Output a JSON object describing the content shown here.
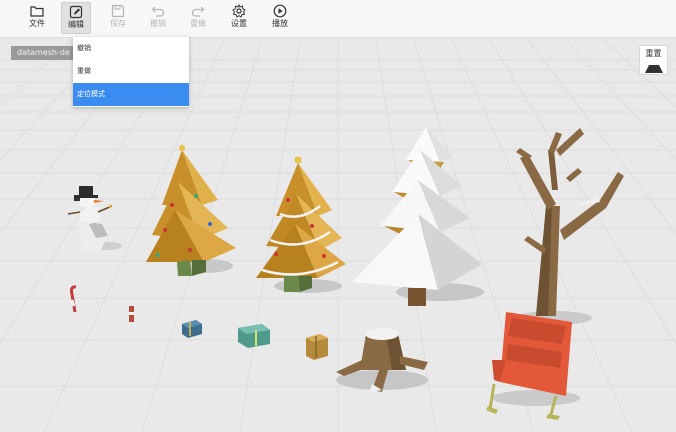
{
  "toolbar": {
    "items": [
      {
        "label": "文件",
        "icon": "folder-icon"
      },
      {
        "label": "编辑",
        "icon": "edit-icon"
      },
      {
        "label": "保存",
        "icon": "save-icon"
      },
      {
        "label": "撤销",
        "icon": "undo-icon"
      },
      {
        "label": "重做",
        "icon": "redo-icon"
      },
      {
        "label": "设置",
        "icon": "gear-icon"
      },
      {
        "label": "播放",
        "icon": "play-icon"
      }
    ]
  },
  "edit_menu": {
    "items": [
      {
        "label": "撤销"
      },
      {
        "label": "重做"
      },
      {
        "label": "定位模式"
      }
    ]
  },
  "scene": {
    "label": "datamesh-de",
    "reset_label": "重置"
  },
  "colors": {
    "selection": "#3b8cf0",
    "toolbar_bg": "#f7f7f7",
    "floor": "#e9e9e9",
    "sleigh": "#e4583a",
    "tree_gold": "#d9a43a"
  }
}
